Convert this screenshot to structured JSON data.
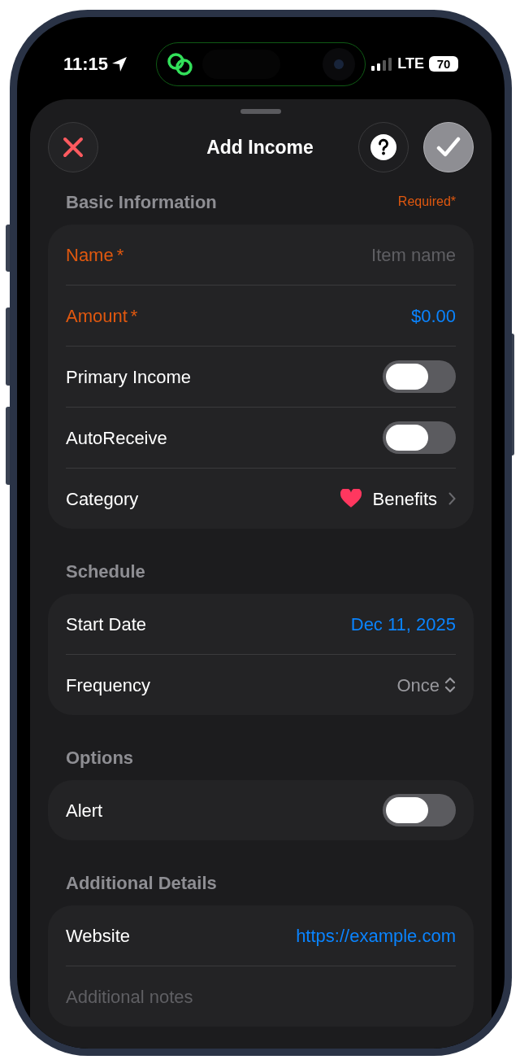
{
  "status_bar": {
    "time": "11:15",
    "network": "LTE",
    "battery": "70"
  },
  "header": {
    "title": "Add Income"
  },
  "sections": [
    {
      "title": "Basic Information",
      "note": "Required*",
      "rows": [
        {
          "kind": "text_field",
          "label": "Name",
          "required": true,
          "mark": "*",
          "placeholder": "Item name"
        },
        {
          "kind": "value",
          "label": "Amount",
          "required": true,
          "mark": "*",
          "value": "$0.00"
        },
        {
          "kind": "toggle",
          "label": "Primary Income",
          "on": false
        },
        {
          "kind": "toggle",
          "label": "AutoReceive",
          "on": false
        },
        {
          "kind": "picker",
          "label": "Category",
          "value": "Benefits"
        }
      ]
    },
    {
      "title": "Schedule",
      "rows": [
        {
          "kind": "value",
          "label": "Start Date",
          "value": "Dec 11, 2025"
        },
        {
          "kind": "menu",
          "label": "Frequency",
          "value": "Once"
        }
      ]
    },
    {
      "title": "Options",
      "rows": [
        {
          "kind": "toggle",
          "label": "Alert",
          "on": false
        }
      ]
    },
    {
      "title": "Additional Details",
      "rows": [
        {
          "kind": "value",
          "label": "Website",
          "value": "https://example.com"
        },
        {
          "kind": "notes",
          "placeholder": "Additional notes"
        }
      ]
    }
  ]
}
